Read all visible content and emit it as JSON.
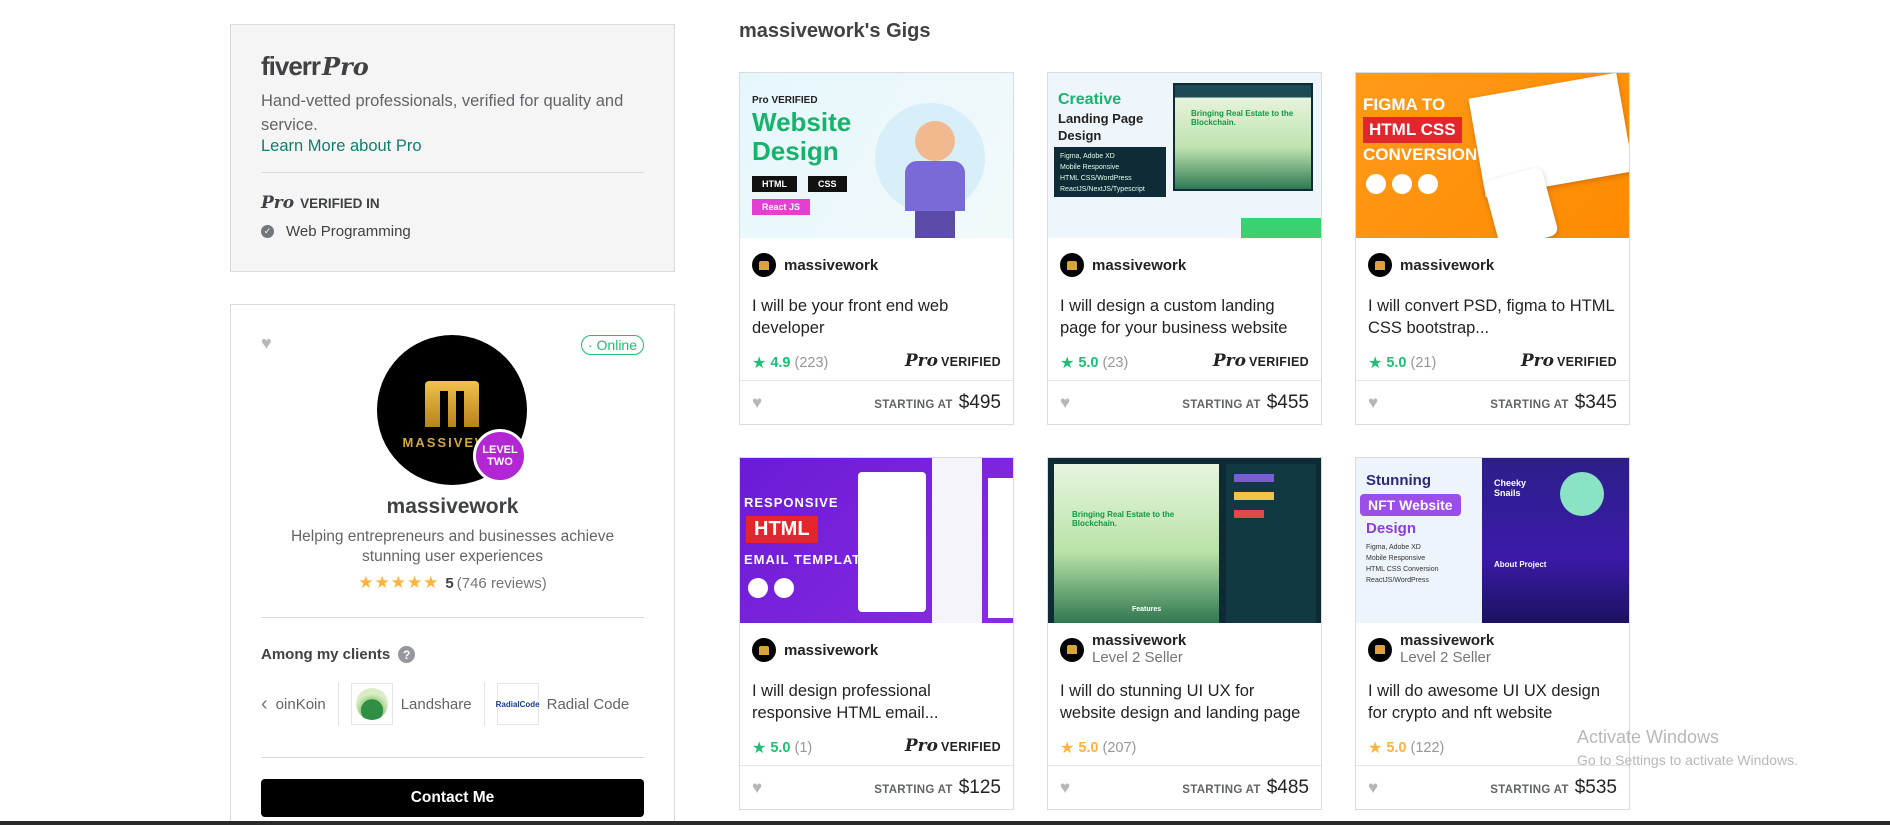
{
  "pro_card": {
    "logo_fiverr": "fiverr",
    "logo_pro": "Pro",
    "description": "Hand-vetted professionals, verified for quality and service.",
    "learn_more": "Learn More about Pro",
    "verified_in_pro": "Pro",
    "verified_in_label": "VERIFIED IN",
    "verified_item": "Web Programming"
  },
  "seller": {
    "online": "Online",
    "avatar_text": "MASSIVEWO",
    "level_line1": "LEVEL",
    "level_line2": "TWO",
    "name": "massivework",
    "tagline": "Helping entrepreneurs and businesses achieve stunning user experiences",
    "stars": "★★★★★",
    "rating": "5",
    "reviews": "(746 reviews)",
    "clients_title": "Among my clients",
    "clients": [
      {
        "name": "oinKoin"
      },
      {
        "name": "Landshare"
      },
      {
        "name": "Radial Code",
        "logo_text": "RadialCode"
      }
    ],
    "contact_label": "Contact Me"
  },
  "gigs_title": "massivework's Gigs",
  "gigs": [
    {
      "seller": "massivework",
      "level": "",
      "title": "I will be your front end web developer",
      "rating": "4.9",
      "count": "(223)",
      "star_color": "green",
      "pro": true,
      "price_label": "STARTING AT",
      "price": "$495",
      "art": {
        "line1": "Pro VERIFIED",
        "line2": "Website",
        "line3": "Design",
        "tag1": "HTML",
        "tag2": "CSS",
        "tag3": "React JS"
      }
    },
    {
      "seller": "massivework",
      "level": "",
      "title": "I will design a custom landing page for your business website",
      "rating": "5.0",
      "count": "(23)",
      "star_color": "green",
      "pro": true,
      "price_label": "STARTING AT",
      "price": "$455",
      "art": {
        "line1": "Creative",
        "line2": "Landing Page",
        "line3": "Design",
        "bullets": [
          "Figma, Adobe XD",
          "Mobile Responsive",
          "HTML CSS/WordPress",
          "ReactJS/NextJS/Typescript"
        ],
        "preview": "Bringing Real Estate to the Blockchain."
      }
    },
    {
      "seller": "massivework",
      "level": "",
      "title": "I will convert PSD, figma to HTML CSS bootstrap...",
      "rating": "5.0",
      "count": "(21)",
      "star_color": "green",
      "pro": true,
      "price_label": "STARTING AT",
      "price": "$345",
      "art": {
        "line1": "FIGMA TO",
        "line2": "HTML CSS",
        "line3": "CONVERSION"
      }
    },
    {
      "seller": "massivework",
      "level": "",
      "title": "I will design professional responsive HTML email...",
      "rating": "5.0",
      "count": "(1)",
      "star_color": "green",
      "pro": true,
      "price_label": "STARTING AT",
      "price": "$125",
      "art": {
        "line1": "RESPONSIVE",
        "line2": "HTML",
        "line3": "EMAIL TEMPLATES"
      }
    },
    {
      "seller": "massivework",
      "level": "Level 2 Seller",
      "title": "I will do stunning UI UX for website design and landing page",
      "rating": "5.0",
      "count": "(207)",
      "star_color": "gold",
      "pro": false,
      "price_label": "STARTING AT",
      "price": "$485",
      "art": {
        "preview": "Bringing Real Estate to the Blockchain.",
        "caption": "Features"
      }
    },
    {
      "seller": "massivework",
      "level": "Level 2 Seller",
      "title": "I will do awesome UI UX design for crypto and nft website",
      "rating": "5.0",
      "count": "(122)",
      "star_color": "gold",
      "pro": false,
      "price_label": "STARTING AT",
      "price": "$535",
      "art": {
        "line1": "Stunning",
        "line2": "NFT Website",
        "line3": "Design",
        "bullets": [
          "Figma, Adobe XD",
          "Mobile Responsive",
          "HTML CSS Conversion",
          "ReactJS/WordPress"
        ],
        "preview": "Cheeky Snails",
        "caption": "About Project"
      }
    }
  ],
  "watermark": {
    "line1": "Activate Windows",
    "line2": "Go to Settings to activate Windows."
  },
  "colors": {
    "green": "#1dbf73",
    "gold": "#ffb33e",
    "level_badge": "#b226d4"
  }
}
